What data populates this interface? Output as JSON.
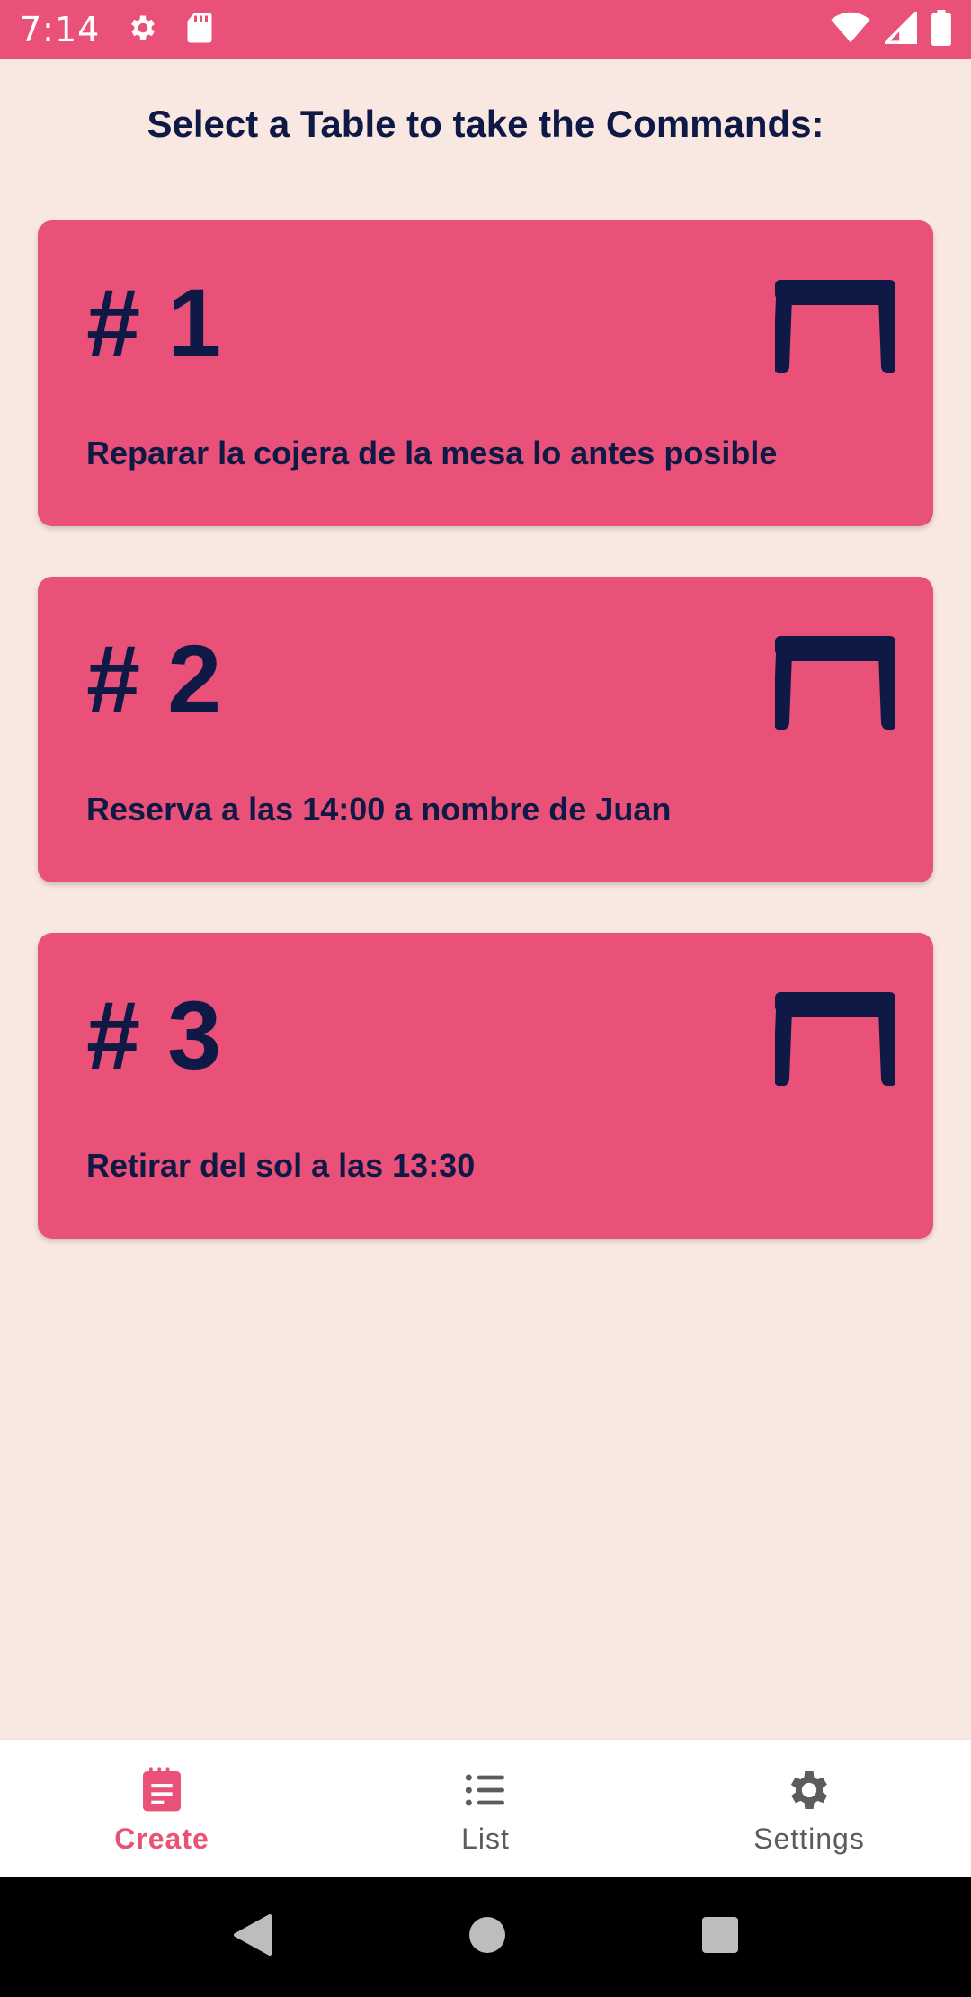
{
  "status_bar": {
    "time": "7:14",
    "icons": [
      "gear-icon",
      "sd-card-icon",
      "wifi-icon",
      "signal-icon",
      "battery-icon"
    ]
  },
  "header": {
    "title": "Select a Table to take the Commands:"
  },
  "tables": [
    {
      "number": "# 1",
      "note": "Reparar la cojera de la mesa lo antes posible",
      "icon": "table-icon"
    },
    {
      "number": "# 2",
      "note": "Reserva a las 14:00 a nombre de Juan",
      "icon": "table-icon"
    },
    {
      "number": "# 3",
      "note": "Retirar del sol a las 13:30",
      "icon": "table-icon"
    }
  ],
  "bottom_nav": {
    "items": [
      {
        "label": "Create",
        "icon": "notepad-icon",
        "active": true
      },
      {
        "label": "List",
        "icon": "list-icon",
        "active": false
      },
      {
        "label": "Settings",
        "icon": "gear-icon",
        "active": false
      }
    ]
  },
  "system_nav": {
    "buttons": [
      "back-icon",
      "home-icon",
      "recents-icon"
    ]
  },
  "colors": {
    "accent": "#EA5178",
    "background": "#F9E8E1",
    "text_dark": "#0E1A45",
    "nav_inactive": "#5C5C5C"
  }
}
